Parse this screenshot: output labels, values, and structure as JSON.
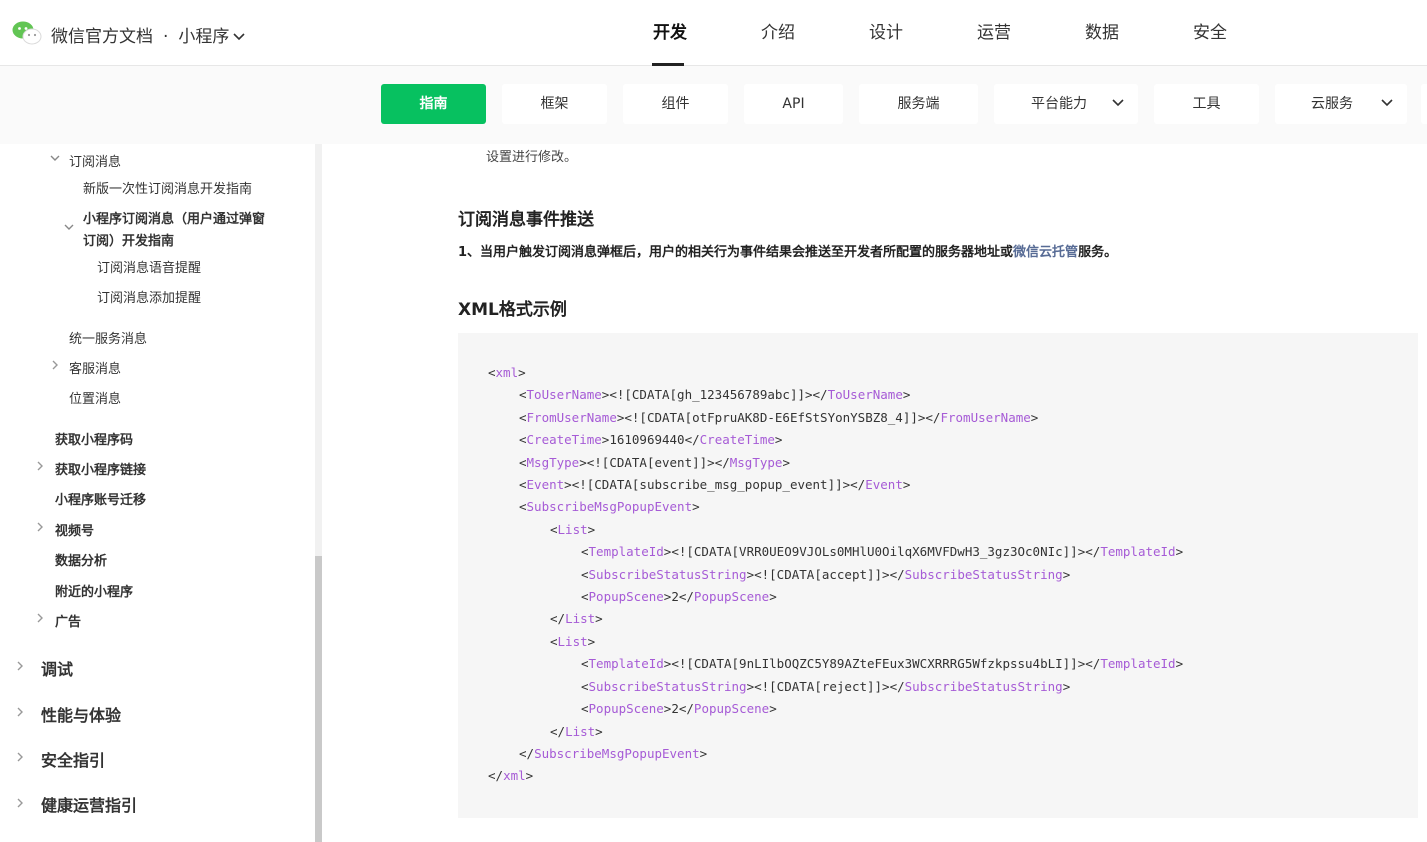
{
  "header": {
    "brand": "微信官方文档",
    "dot": "·",
    "section": "小程序",
    "nav": [
      "开发",
      "介绍",
      "设计",
      "运营",
      "数据",
      "安全"
    ],
    "active_nav": "开发"
  },
  "subnav": {
    "items": [
      "指南",
      "框架",
      "组件",
      "API",
      "服务端",
      "平台能力",
      "工具",
      "云服务"
    ]
  },
  "sidebar": {
    "subscribe": "订阅消息",
    "new_once": "新版一次性订阅消息开发指南",
    "mini_sub_line1": "小程序订阅消息（用户通过弹窗",
    "mini_sub_line2": "订阅）开发指南",
    "voice": "订阅消息语音提醒",
    "add_remind": "订阅消息添加提醒",
    "unified": "统一服务消息",
    "customer": "客服消息",
    "location": "位置消息",
    "get_code": "获取小程序码",
    "get_link": "获取小程序链接",
    "migrate": "小程序账号迁移",
    "channels": "视频号",
    "analytics": "数据分析",
    "nearby": "附近的小程序",
    "ads": "广告",
    "debug": "调试",
    "perf": "性能与体验",
    "security": "安全指引",
    "health": "健康运营指引"
  },
  "content": {
    "ghost_text": "设置进行修改。",
    "event_heading": "订阅消息事件推送",
    "event_para_pre": "1、当用户触发订阅消息弹框后，用户的相关行为事件结果会推送至开发者所配置的服务器地址或",
    "event_link": "微信云托管",
    "event_para_post": "服务。",
    "xml_heading": "XML格式示例"
  },
  "code_lines": [
    {
      "indent": 0,
      "open": "xml",
      "text": "",
      "close": ""
    },
    {
      "indent": 1,
      "open": "ToUserName",
      "text": "<![CDATA[gh_123456789abc]]>",
      "close": "ToUserName"
    },
    {
      "indent": 1,
      "open": "FromUserName",
      "text": "<![CDATA[otFpruAK8D-E6EfStSYonYSBZ8_4]]>",
      "close": "FromUserName"
    },
    {
      "indent": 1,
      "open": "CreateTime",
      "text": "1610969440",
      "close": "CreateTime"
    },
    {
      "indent": 1,
      "open": "MsgType",
      "text": "<![CDATA[event]]>",
      "close": "MsgType"
    },
    {
      "indent": 1,
      "open": "Event",
      "text": "<![CDATA[subscribe_msg_popup_event]]>",
      "close": "Event"
    },
    {
      "indent": 1,
      "open": "SubscribeMsgPopupEvent",
      "text": "",
      "close": ""
    },
    {
      "indent": 2,
      "open": "List",
      "text": "",
      "close": ""
    },
    {
      "indent": 3,
      "open": "TemplateId",
      "text": "<![CDATA[VRR0UEO9VJOLs0MHlU0OilqX6MVFDwH3_3gz3Oc0NIc]]>",
      "close": "TemplateId"
    },
    {
      "indent": 3,
      "open": "SubscribeStatusString",
      "text": "<![CDATA[accept]]>",
      "close": "SubscribeStatusString"
    },
    {
      "indent": 3,
      "open": "PopupScene",
      "text": "2",
      "close": "PopupScene"
    },
    {
      "indent": 2,
      "open": "",
      "text": "",
      "close": "List"
    },
    {
      "indent": 2,
      "open": "List",
      "text": "",
      "close": ""
    },
    {
      "indent": 3,
      "open": "TemplateId",
      "text": "<![CDATA[9nLIlbOQZC5Y89AZteFEux3WCXRRRG5Wfzkpssu4bLI]]>",
      "close": "TemplateId"
    },
    {
      "indent": 3,
      "open": "SubscribeStatusString",
      "text": "<![CDATA[reject]]>",
      "close": "SubscribeStatusString"
    },
    {
      "indent": 3,
      "open": "PopupScene",
      "text": "2",
      "close": "PopupScene"
    },
    {
      "indent": 2,
      "open": "",
      "text": "",
      "close": "List"
    },
    {
      "indent": 1,
      "open": "",
      "text": "",
      "close": "SubscribeMsgPopupEvent"
    },
    {
      "indent": 0,
      "open": "",
      "text": "",
      "close": "xml"
    }
  ],
  "colors": {
    "accent": "#07c160",
    "link": "#576b95",
    "xml_tag": "#a65bd6"
  }
}
